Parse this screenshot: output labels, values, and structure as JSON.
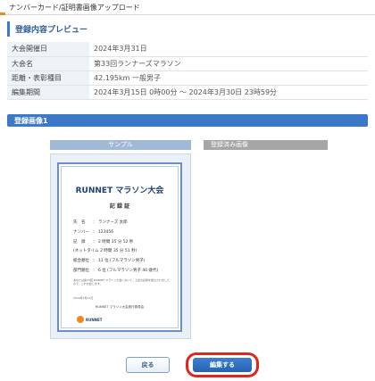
{
  "header": {
    "title": "ナンバーカード/証明書画像アップロード",
    "accent_color": "#f08a1c"
  },
  "preview": {
    "title": "登録内容プレビュー",
    "rows": [
      {
        "label": "大会開催日",
        "value": "2024年3月31日"
      },
      {
        "label": "大会名",
        "value": "第33回ランナーズマラソン"
      },
      {
        "label": "距離・表彰種目",
        "value": "42.195km 一般男子"
      },
      {
        "label": "編集期間",
        "value": "2024年3月15日 0時00分 〜 2024年3月30日 23時59分"
      }
    ]
  },
  "image_section": {
    "title": "登録画像1",
    "sample_label": "サンプル",
    "registered_label": "登録済み画像"
  },
  "certificate": {
    "title": "RUNNET マラソン大会",
    "subtitle": "記 録 証",
    "rows": [
      {
        "key": "氏　名",
        "value": "ランナーズ 太郎"
      },
      {
        "key": "ナンバー",
        "value": "123456"
      },
      {
        "key": "記　録",
        "value": "2 時間 35 分 52 秒"
      },
      {
        "key": "",
        "value": "(ネットタイム 2 時間 35 分 51 秒)"
      },
      {
        "key": "総合順位",
        "value": "11 位 (フルマラソン男子)"
      },
      {
        "key": "部門順位",
        "value": "6 位 (フルマラソン男子 40 歳代)"
      }
    ],
    "note": "あなたは第33回 RUNNET マラソン大会において、上記の記録を樹立されましたので、これを証します。",
    "date": "2024年3月31日",
    "org": "RUNNET マラソン大会実行委員会",
    "logo_text": "RUNNET"
  },
  "buttons": {
    "back": "戻る",
    "edit": "編集する"
  },
  "colors": {
    "primary_blue": "#3b79c6",
    "highlight_red": "#e0261c"
  }
}
